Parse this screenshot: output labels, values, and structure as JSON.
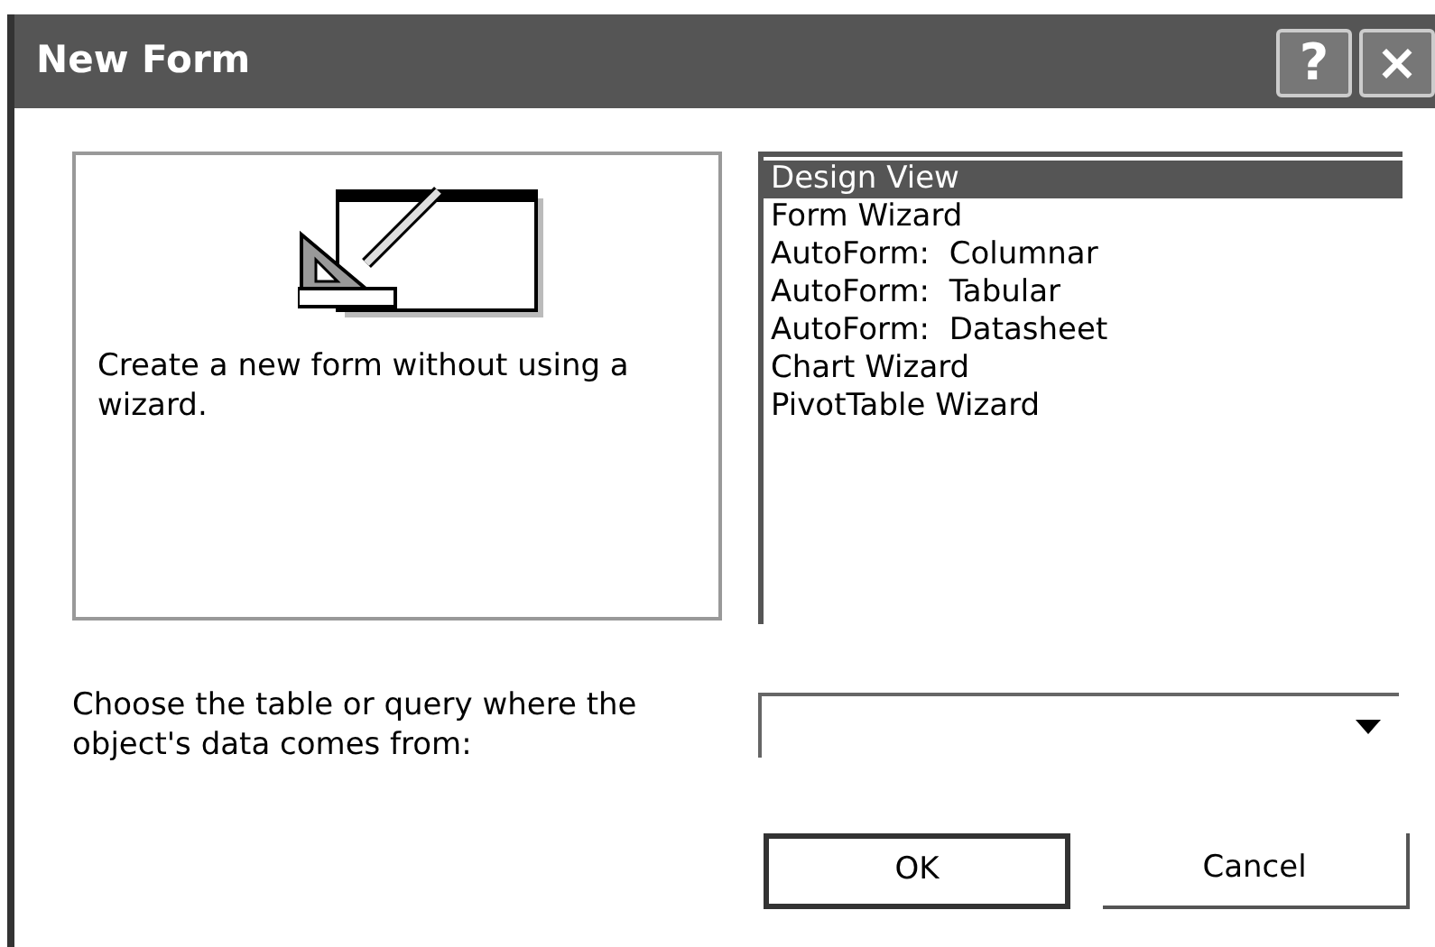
{
  "window": {
    "title": "New Form",
    "title_buttons": [
      "?",
      "×"
    ]
  },
  "preview": {
    "description": "Create a new form without using a wizard."
  },
  "options": [
    {
      "label": "Design View",
      "selected": true
    },
    {
      "label": "Form Wizard",
      "selected": false
    },
    {
      "label": "AutoForm:  Columnar",
      "selected": false
    },
    {
      "label": "AutoForm:  Tabular",
      "selected": false
    },
    {
      "label": "AutoForm:  Datasheet",
      "selected": false
    },
    {
      "label": "Chart Wizard",
      "selected": false
    },
    {
      "label": "PivotTable Wizard",
      "selected": false
    }
  ],
  "source": {
    "label": "Choose the table or query where the object's data comes from:"
  },
  "buttons": [
    {
      "label": "OK",
      "default": true
    },
    {
      "label": "Cancel",
      "default": false
    }
  ]
}
